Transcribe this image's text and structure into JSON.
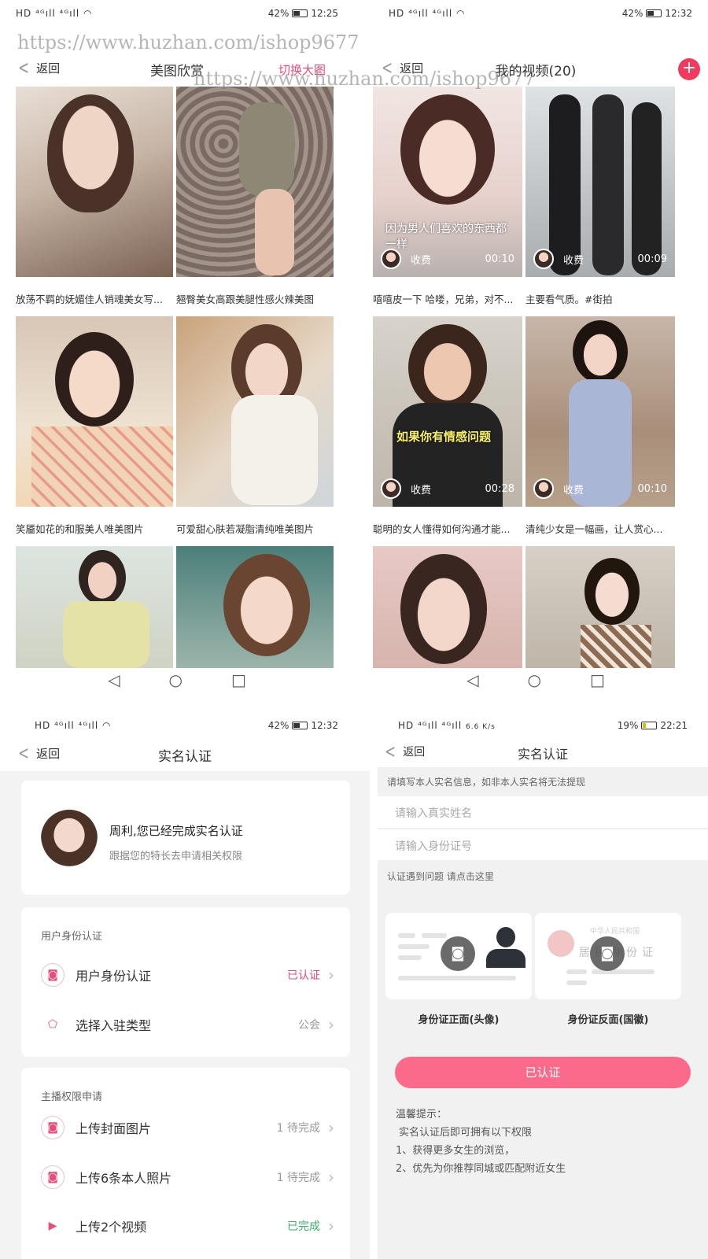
{
  "watermark": {
    "line1": "https://www.huzhan.com/ishop9677",
    "line2": "https://www.huzhan.com/ishop9677"
  },
  "panel1": {
    "status": {
      "battery": "42%",
      "time": "12:25"
    },
    "back_label": "返回",
    "title": "美图欣赏",
    "action_label": "切换大图",
    "captions": [
      "放荡不羁的妩媚佳人销魂美女写...",
      "翘臀美女高跟美腿性感火辣美图",
      "笑靥如花的和服美人唯美图片",
      "可爱甜心肤若凝脂清纯唯美图片"
    ]
  },
  "panel2": {
    "status": {
      "battery": "42%",
      "time": "12:32"
    },
    "back_label": "返回",
    "title": "我的视频(20)",
    "plus_icon": "plus-icon",
    "videos": [
      {
        "overlay": "因为男人们喜欢的东西都一样",
        "price": "收费",
        "duration": "00:10",
        "caption": "嘻嘻皮一下 哈喽，兄弟，对不..."
      },
      {
        "overlay": "",
        "price": "收费",
        "duration": "00:09",
        "caption": "主要看气质。#街拍"
      },
      {
        "overlay": "如果你有情感问题",
        "price": "收费",
        "duration": "00:28",
        "caption": "聪明的女人懂得如何沟通才能..."
      },
      {
        "overlay": "",
        "price": "收费",
        "duration": "00:10",
        "caption": "清纯少女是一幅画，让人赏心..."
      }
    ]
  },
  "panel3": {
    "status": {
      "battery": "42%",
      "time": "12:32"
    },
    "back_label": "返回",
    "title": "实名认证",
    "profile": {
      "headline": "周利,您已经完成实名认证",
      "subtitle": "跟据您的特长去申请相关权限"
    },
    "identity": {
      "title": "用户身份认证",
      "rows": [
        {
          "label": "用户身份认证",
          "value": "已认证"
        },
        {
          "label": "选择入驻类型",
          "value": "公会"
        }
      ]
    },
    "anchor": {
      "title": "主播权限申请",
      "rows": [
        {
          "label": "上传封面图片",
          "value": "1 待完成"
        },
        {
          "label": "上传6条本人照片",
          "value": "1 待完成"
        },
        {
          "label": "上传2个视频",
          "value": "已完成"
        }
      ]
    }
  },
  "panel4": {
    "status": {
      "battery": "19%",
      "time": "22:21",
      "speed": "6.6 K/s"
    },
    "back_label": "返回",
    "title": "实名认证",
    "notice": "请填写本人实名信息，如非本人实名将无法提现",
    "name_placeholder": "请输入真实姓名",
    "id_placeholder": "请输入身份证号",
    "help": "认证遇到问题 请点击这里",
    "card_back_text1": "中华人民共和国",
    "card_back_text2": "居民身份证",
    "front_label": "身份证正面(头像)",
    "back_label_card": "身份证反面(国徽)",
    "button": "已认证",
    "tips_title": "温馨提示：",
    "tips": [
      "实名认证后即可拥有以下权限",
      "1、获得更多女生的浏览，",
      "2、优先为你推荐同城或匹配附近女生"
    ]
  },
  "colors": {
    "accent": "#e84c78",
    "button": "#fc6a8b",
    "done": "#36b36a"
  }
}
